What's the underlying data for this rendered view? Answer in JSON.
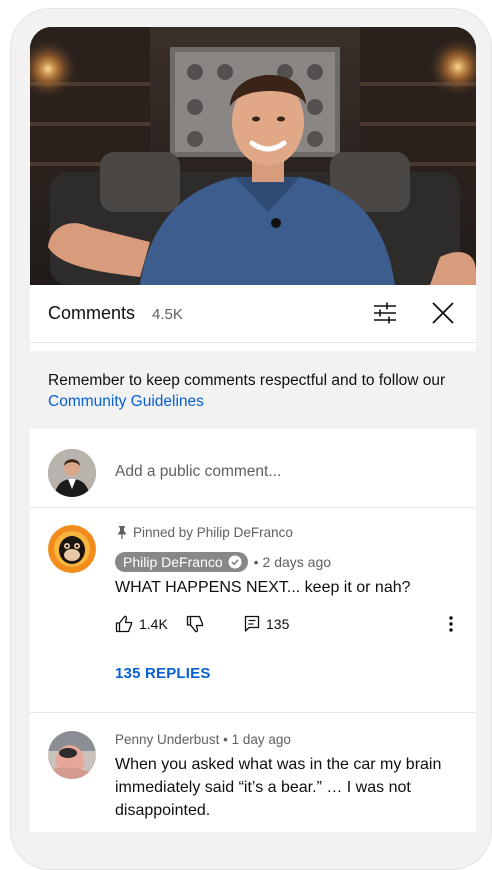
{
  "header": {
    "title": "Comments",
    "count": "4.5K"
  },
  "notice": {
    "text": "Remember to keep comments respectful and to follow our ",
    "link": "Community Guidelines"
  },
  "add_comment": {
    "placeholder": "Add a public comment..."
  },
  "comments": [
    {
      "pinned_label": "Pinned by Philip DeFranco",
      "author": "Philip DeFranco",
      "time": "2 days ago",
      "text": "WHAT HAPPENS NEXT... keep it or nah?",
      "likes": "1.4K",
      "reply_count": "135",
      "replies_label": "135 REPLIES"
    },
    {
      "author": "Penny Underbust",
      "time": "1 day ago",
      "text": "When you asked what was in the car my brain immediately said “it’s a bear.” … I was not disappointed."
    }
  ],
  "colors": {
    "link": "#065fd4",
    "secondary_text": "#606060",
    "badge": "#888888"
  },
  "icons": [
    "filter-icon",
    "close-icon",
    "pin-icon",
    "verified-icon",
    "thumbs-up-icon",
    "thumbs-down-icon",
    "reply-icon",
    "more-vert-icon"
  ]
}
